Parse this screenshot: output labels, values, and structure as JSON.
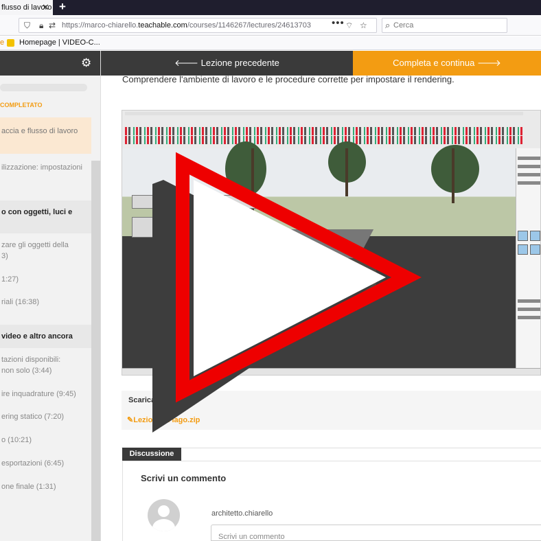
{
  "browser": {
    "tab_title": "flusso di lavoro",
    "tab_close": "✕",
    "new_tab": "+",
    "url_prefix": "https://marco-chiarello.",
    "url_domain": "teachable.com",
    "url_path": "/courses/1146267/lectures/24613703",
    "url_dots": "•••",
    "search_placeholder": "Cerca",
    "bookmark_left": "e",
    "bookmark_label": "Homepage | VIDEO-C..."
  },
  "sidebar": {
    "completed_label": "COMPLETATO",
    "items": [
      {
        "kind": "item",
        "label": "accia e flusso di lavoro",
        "active": true
      },
      {
        "kind": "item",
        "label": "ilizzazione: impostazioni"
      },
      {
        "kind": "section",
        "label": "o con oggetti, luci e"
      },
      {
        "kind": "item",
        "label": "zare gli oggetti della\n3)"
      },
      {
        "kind": "item",
        "label": "1:27)"
      },
      {
        "kind": "item",
        "label": "riali (16:38)"
      },
      {
        "kind": "section",
        "label": "video e altro ancora"
      },
      {
        "kind": "item",
        "label": "tazioni disponibili:\nnon solo (3:44)"
      },
      {
        "kind": "item",
        "label": "ire inquadrature (9:45)"
      },
      {
        "kind": "item",
        "label": "ering statico (7:20)"
      },
      {
        "kind": "item",
        "label": "o (10:21)"
      },
      {
        "kind": "item",
        "label": "esportazioni (6:45)"
      },
      {
        "kind": "item",
        "label": "one finale (1:31)"
      }
    ]
  },
  "nav": {
    "prev_label": "Lezione precedente",
    "next_label": "Completa e continua",
    "prev_arrow": "🡐",
    "next_arrow": "🡒"
  },
  "lecture": {
    "lead_text": "Comprendere l'ambiente di lavoro e le procedure corrette per impostare il rendering.",
    "download_title": "Scarica",
    "download_file": "Lezio...sul lago.zip"
  },
  "discussion": {
    "tab_label": "Discussione",
    "title": "Scrivi un commento",
    "username": "architetto.chiarello",
    "comment_placeholder": "Scrivi un commento"
  },
  "colors": {
    "accent": "#f39c12",
    "dark": "#3a3a3a",
    "play_red": "#ee0000"
  }
}
